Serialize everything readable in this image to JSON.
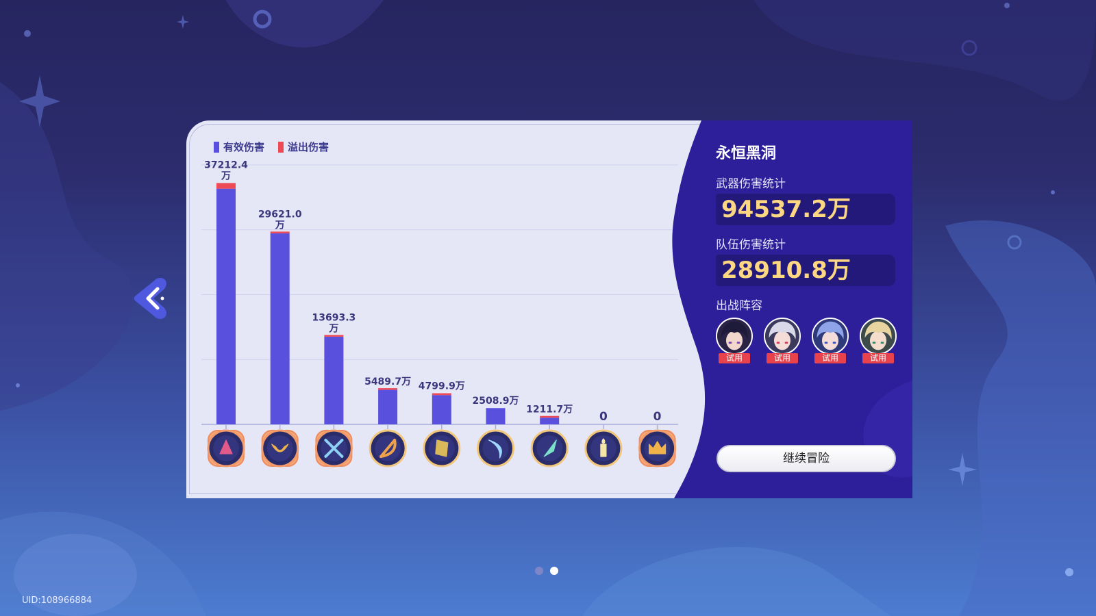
{
  "legend": {
    "effective_label": "有效伤害",
    "overflow_label": "溢出伤害",
    "effective_color": "#5a50de",
    "overflow_color": "#ee4a56"
  },
  "chart_data": {
    "type": "bar",
    "stacked": true,
    "categories": [
      "weapon-1",
      "weapon-2",
      "weapon-3",
      "weapon-4",
      "weapon-5",
      "weapon-6",
      "weapon-7",
      "weapon-8",
      "weapon-9"
    ],
    "labels": [
      "37212.4\n万",
      "29621.0\n万",
      "13693.3\n万",
      "5489.7万",
      "4799.9万",
      "2508.9万",
      "1211.7万",
      "0",
      "0"
    ],
    "series": [
      {
        "name": "有效伤害",
        "values": [
          36340,
          29460,
          13520,
          5320,
          4510,
          2508.9,
          1030,
          0,
          0
        ]
      },
      {
        "name": "溢出伤害",
        "values": [
          872.4,
          161.0,
          173.3,
          169.7,
          289.9,
          0,
          181.7,
          0,
          0
        ]
      }
    ],
    "ylim": [
      0,
      40000
    ],
    "grid": true,
    "legend_position": "top-left"
  },
  "weapons": [
    {
      "icon": "crystal-orb-weapon-icon",
      "frame": "orange"
    },
    {
      "icon": "boomerang-weapon-icon",
      "frame": "orange"
    },
    {
      "icon": "crossed-blades-weapon-icon",
      "frame": "orange"
    },
    {
      "icon": "bow-weapon-icon",
      "frame": "gold"
    },
    {
      "icon": "tome-weapon-icon",
      "frame": "gold"
    },
    {
      "icon": "crescent-blade-weapon-icon",
      "frame": "gold"
    },
    {
      "icon": "crystal-shard-weapon-icon",
      "frame": "gold"
    },
    {
      "icon": "candle-weapon-icon",
      "frame": "gold"
    },
    {
      "icon": "crown-weapon-icon",
      "frame": "orange"
    }
  ],
  "stage": {
    "title": "永恒黑洞"
  },
  "stats": {
    "weapon_damage_label": "武器伤害统计",
    "weapon_damage_value": "94537.2万",
    "team_damage_label": "队伍伤害统计",
    "team_damage_value": "28910.8万"
  },
  "team": {
    "label": "出战阵容",
    "members": [
      {
        "tag": "试用",
        "hair": "#1e1a3a"
      },
      {
        "tag": "试用",
        "hair": "#d9d9ea"
      },
      {
        "tag": "试用",
        "hair": "#8fa3e8"
      },
      {
        "tag": "试用",
        "hair": "#e8d4a0"
      }
    ]
  },
  "continue_label": "继续冒险",
  "uid": "UID:108966884",
  "page_dots": {
    "total": 2,
    "active": 1
  }
}
